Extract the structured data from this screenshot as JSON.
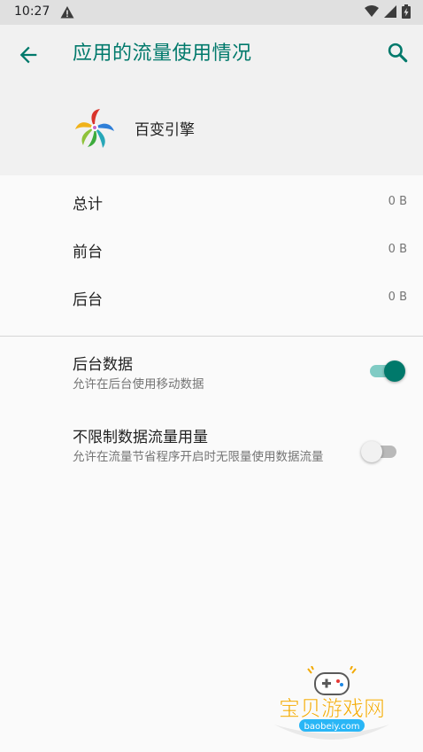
{
  "status_bar": {
    "time": "10:27",
    "icons": [
      "warning-icon",
      "wifi-icon",
      "signal-icon",
      "battery-icon"
    ]
  },
  "header": {
    "title": "应用的流量使用情况",
    "back_icon": "arrow-left-icon",
    "search_icon": "search-icon",
    "accent_color": "#00796b"
  },
  "app": {
    "name": "百变引擎",
    "icon": "app-logo-icon"
  },
  "usage": [
    {
      "label": "总计",
      "value": "0 B"
    },
    {
      "label": "前台",
      "value": "0 B"
    },
    {
      "label": "后台",
      "value": "0 B"
    }
  ],
  "settings": [
    {
      "label": "后台数据",
      "summary": "允许在后台使用移动数据",
      "enabled": true
    },
    {
      "label": "不限制数据流量用量",
      "summary": "允许在流量节省程序开启时无限量使用数据流量",
      "enabled": false
    }
  ],
  "watermark": {
    "text": "宝贝游戏网",
    "domain": "baobeiy.com"
  }
}
